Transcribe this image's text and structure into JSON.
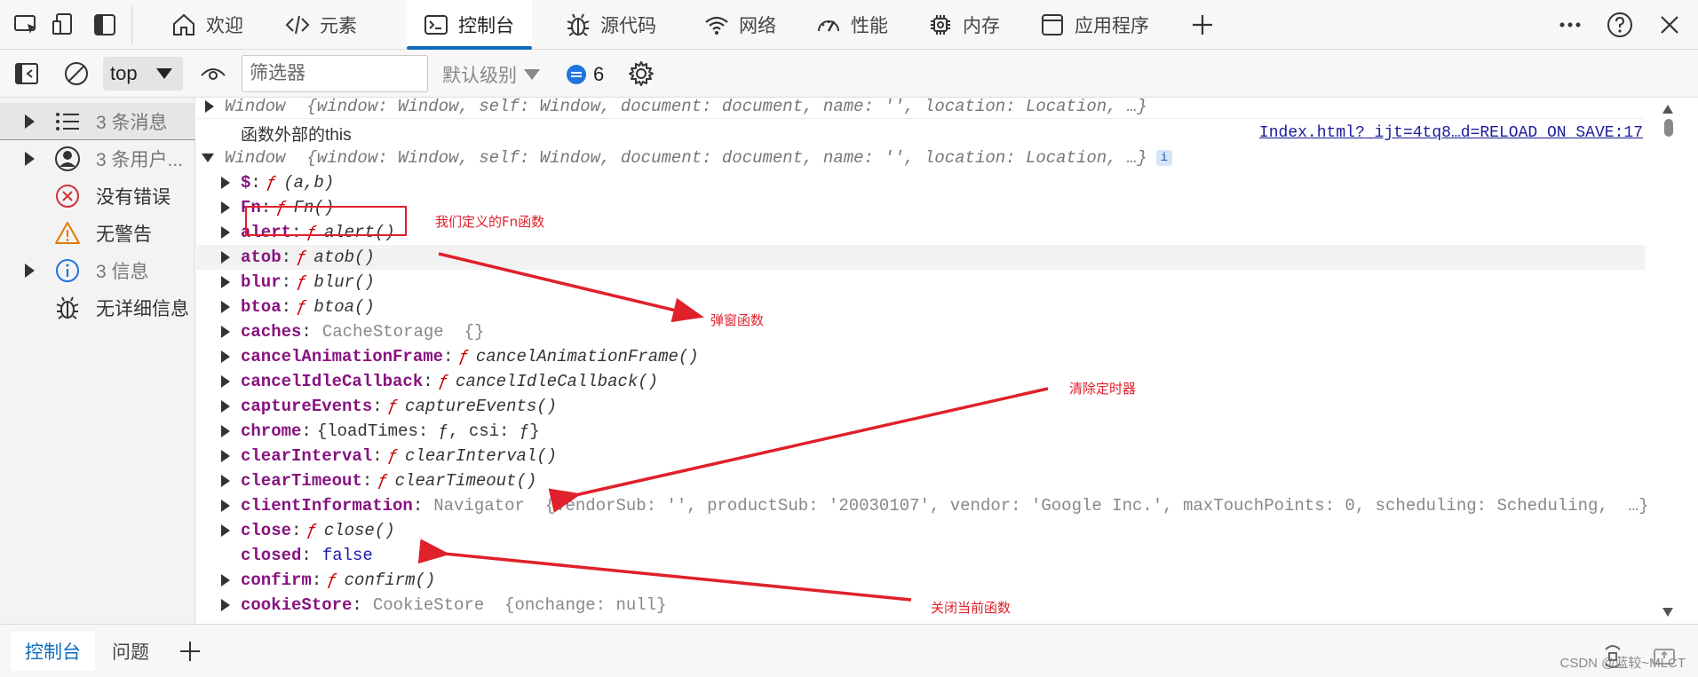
{
  "topbar": {
    "tabs": [
      {
        "label": "欢迎",
        "icon": "home-icon"
      },
      {
        "label": "元素",
        "icon": "code-tag-icon"
      },
      {
        "label": "控制台",
        "icon": "console-icon",
        "active": true
      },
      {
        "label": "源代码",
        "icon": "bug-icon"
      },
      {
        "label": "网络",
        "icon": "wifi-icon"
      },
      {
        "label": "性能",
        "icon": "gauge-icon"
      },
      {
        "label": "内存",
        "icon": "chip-icon"
      },
      {
        "label": "应用程序",
        "icon": "window-icon"
      }
    ]
  },
  "toolbar": {
    "context": "top",
    "filter_placeholder": "筛选器",
    "level": "默认级别",
    "message_count": "6"
  },
  "sidebar": {
    "items": [
      {
        "label": "3 条消息",
        "icon": "list-icon",
        "expandable": true
      },
      {
        "label": "3 条用户...",
        "icon": "user-icon",
        "expandable": true
      },
      {
        "label": "没有错误",
        "icon": "error-circle-icon",
        "expandable": false
      },
      {
        "label": "无警告",
        "icon": "warning-icon",
        "expandable": false
      },
      {
        "label": "3 信息",
        "icon": "info-icon",
        "expandable": true
      },
      {
        "label": "无详细信息",
        "icon": "bug-icon",
        "expandable": false
      }
    ]
  },
  "console": {
    "window_summary": "{window: Window, self: Window, document: document, name: '', location: Location, …}",
    "window_label": "Window",
    "log_text": "函数外部的this",
    "source_link": "Index.html?_ijt=4tq8…d=RELOAD_ON_SAVE:17",
    "info_badge": "i",
    "func_symbol": "ƒ",
    "props": [
      {
        "key": "$",
        "value": "(a,b)"
      },
      {
        "key": "Fn",
        "value": "Fn()"
      },
      {
        "key": "alert",
        "value": "alert()"
      },
      {
        "key": "atob",
        "value": "atob()"
      },
      {
        "key": "blur",
        "value": "blur()"
      },
      {
        "key": "btoa",
        "value": "btoa()"
      },
      {
        "key": "caches",
        "value": "CacheStorage  {}"
      },
      {
        "key": "cancelAnimationFrame",
        "value": "cancelAnimationFrame()"
      },
      {
        "key": "cancelIdleCallback",
        "value": "cancelIdleCallback()"
      },
      {
        "key": "captureEvents",
        "value": "captureEvents()"
      },
      {
        "key": "chrome",
        "value": "{loadTimes: ƒ, csi: ƒ}"
      },
      {
        "key": "clearInterval",
        "value": "clearInterval()"
      },
      {
        "key": "clearTimeout",
        "value": "clearTimeout()"
      },
      {
        "key": "clientInformation",
        "value": "Navigator  {vendorSub: '', productSub: '20030107', vendor: 'Google Inc.', maxTouchPoints: 0, scheduling: Scheduling,  …}"
      },
      {
        "key": "close",
        "value": "close()"
      },
      {
        "key": "closed",
        "value": "false"
      },
      {
        "key": "confirm",
        "value": "confirm()"
      },
      {
        "key": "cookieStore",
        "value": "CookieStore  {onchange: null}"
      }
    ]
  },
  "annotations": {
    "fn_label": "我们定义的Fn函数",
    "alert_label": "弹窗函数",
    "clear_label": "清除定时器",
    "close_label": "关闭当前函数"
  },
  "bottombar": {
    "tabs": [
      {
        "label": "控制台",
        "active": true
      },
      {
        "label": "问题",
        "active": false
      }
    ],
    "watermark": "CSDN @蓝较~MLCT"
  },
  "colors": {
    "accent": "#0f6cbd",
    "annotation": "#e0202a",
    "key": "#881280"
  }
}
